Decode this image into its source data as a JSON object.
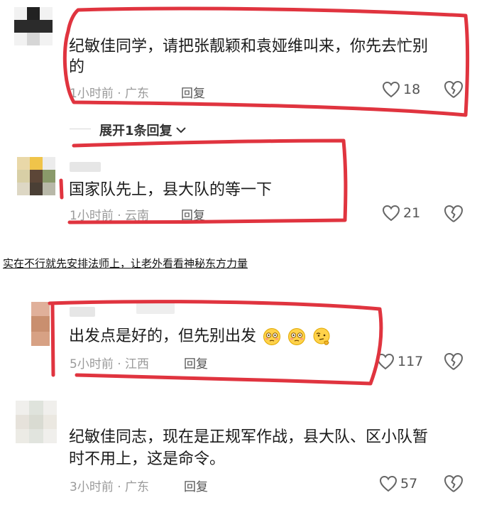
{
  "comments": [
    {
      "text_line1": "纪敏佳同学，请把张靓颖和袁娅维叫来，你先去忙别",
      "text_line2": "的",
      "meta": "1小时前 · 广东",
      "reply_label": "回复",
      "likes": "18"
    },
    {
      "text_line1": "国家队先上，县大队的等一下",
      "meta": "1小时前 · 云南",
      "reply_label": "回复",
      "likes": "21"
    },
    {
      "text_line1": "出发点是好的，但先别出发",
      "meta": "5小时前 · 江西",
      "reply_label": "回复",
      "likes": "117"
    },
    {
      "text_line1": "纪敏佳同志，现在是正规军作战，县大队、区小队暂",
      "text_line2": "时不用上，这是命令。",
      "meta": "3小时前 · 广东",
      "reply_label": "回复",
      "likes": "57"
    }
  ],
  "expand_replies_label": "展开1条回复",
  "overlay_caption": "实在不行就先安排法师上，让老外看看神秘东方力量",
  "icons": {
    "like": "heart-outline-icon",
    "dislike": "broken-heart-icon",
    "expand": "chevron-down-icon",
    "emoji": [
      "flushed-face-emoji",
      "flushed-face-emoji",
      "thinking-face-emoji"
    ]
  },
  "colors": {
    "annotation_red": "#e0343f",
    "meta_gray": "#9a9a9a"
  }
}
